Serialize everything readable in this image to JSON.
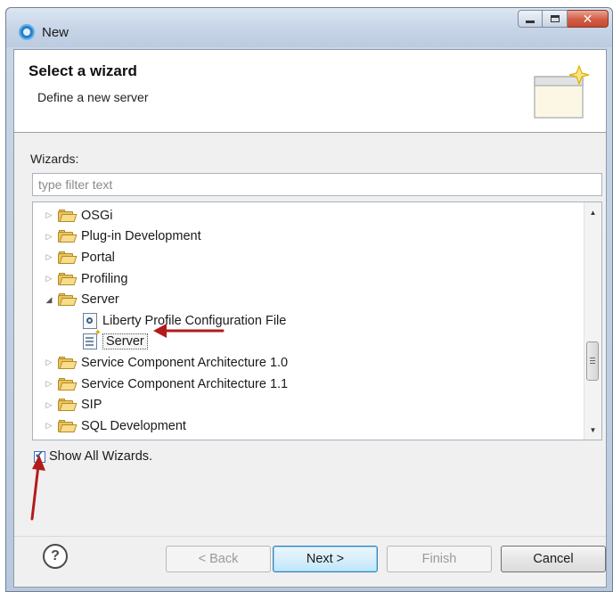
{
  "window": {
    "title": "New"
  },
  "header": {
    "title": "Select a wizard",
    "description": "Define a new server"
  },
  "wizards": {
    "label": "Wizards:",
    "filter_placeholder": "type filter text",
    "tree": [
      {
        "label": "OSGi",
        "type": "folder",
        "expanded": false
      },
      {
        "label": "Plug-in Development",
        "type": "folder",
        "expanded": false
      },
      {
        "label": "Portal",
        "type": "folder",
        "expanded": false
      },
      {
        "label": "Profiling",
        "type": "folder",
        "expanded": false
      },
      {
        "label": "Server",
        "type": "folder",
        "expanded": true
      },
      {
        "label": "Liberty Profile Configuration File",
        "type": "file",
        "icon": "config-file-icon"
      },
      {
        "label": "Server",
        "type": "file",
        "icon": "server-wizard-icon",
        "selected": true
      },
      {
        "label": "Service Component Architecture 1.0",
        "type": "folder",
        "expanded": false
      },
      {
        "label": "Service Component Architecture 1.1",
        "type": "folder",
        "expanded": false
      },
      {
        "label": "SIP",
        "type": "folder",
        "expanded": false
      },
      {
        "label": "SQL Development",
        "type": "folder",
        "expanded": false
      }
    ]
  },
  "show_all": {
    "label": "Show All Wizards.",
    "checked": true
  },
  "buttons": {
    "help": "?",
    "back": "< Back",
    "next": "Next >",
    "finish": "Finish",
    "cancel": "Cancel"
  },
  "colors": {
    "annotation_arrow": "#b31b1b",
    "default_button_border": "#3c7fb1",
    "folder": "#e9c460"
  }
}
